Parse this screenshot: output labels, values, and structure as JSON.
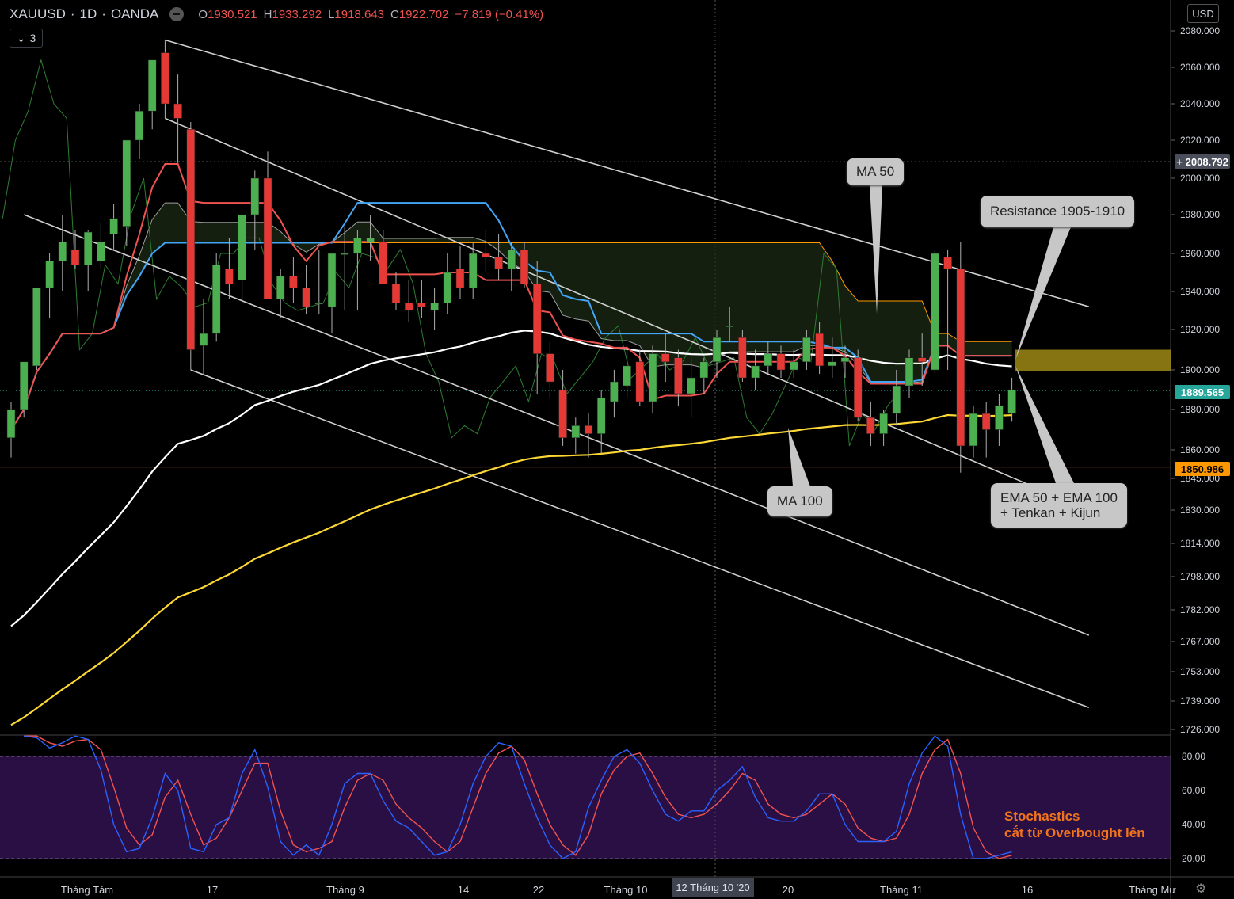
{
  "header": {
    "symbol": "XAUUSD",
    "interval": "1D",
    "source": "OANDA",
    "o_label": "O",
    "o_value": "1930.521",
    "h_label": "H",
    "h_value": "1933.292",
    "l_label": "L",
    "l_value": "1918.643",
    "c_label": "C",
    "c_value": "1922.702",
    "change": "−7.819 (−0.41%)",
    "indicator_count": "3",
    "currency_button": "USD"
  },
  "colors": {
    "background": "#000000",
    "up": "#4caf50",
    "down": "#e53935",
    "tenkan": "#ef5350",
    "kijun": "#42a5f5",
    "ma50": "#ffffff",
    "ma100": "#fdd835",
    "cloud_edge": "#9e9e9e",
    "span_b": "#ff9800",
    "lagging": "#2e7d32",
    "stoch_k": "#2962ff",
    "stoch_d": "#ef5350",
    "stoch_band": "#2a0f44",
    "channel": "#d0d0d0",
    "resistance_zone": "#b39b1a"
  },
  "annotations": {
    "ma50": "MA 50",
    "ma100": "MA 100",
    "resistance": "Resistance 1905-1910",
    "confluence_line1": "EMA 50 + EMA 100",
    "confluence_line2": "+ Tenkan + Kijun",
    "stoch_line1": "Stochastics",
    "stoch_line2": "cắt từ Overbought lên"
  },
  "price_tags": {
    "crosshair": "2008.792",
    "last": "1889.565",
    "horizontal_line": "1850.986"
  },
  "time_axis": {
    "labels": [
      "Tháng Tám",
      "17",
      "Tháng 9",
      "14",
      "22",
      "Tháng 10",
      "20",
      "Tháng 11",
      "16",
      "Tháng Mư"
    ],
    "highlight": "12 Tháng 10 '20"
  },
  "chart_data": {
    "type": "candlestick",
    "title": "XAUUSD 1D OANDA",
    "price_scale": {
      "ticks": [
        2080,
        2060,
        2040,
        2020,
        2000,
        1980,
        1960,
        1940,
        1920,
        1900,
        1880,
        1860,
        1845,
        1830,
        1814,
        1798,
        1782,
        1767,
        1753,
        1739,
        1726
      ],
      "tick_labels": [
        "2080.000",
        "2060.000",
        "2040.000",
        "2020.000",
        "2000.000",
        "1980.000",
        "1960.000",
        "1940.000",
        "1920.000",
        "1900.000",
        "1880.000",
        "1860.000",
        "1845.000",
        "1830.000",
        "1814.000",
        "1798.000",
        "1782.000",
        "1767.000",
        "1753.000",
        "1739.000",
        "1726.000"
      ]
    },
    "candles": [
      [
        1866,
        1884,
        1856,
        1880
      ],
      [
        1880,
        1904,
        1876,
        1904
      ],
      [
        1902,
        1942,
        1900,
        1942
      ],
      [
        1942,
        1960,
        1926,
        1956
      ],
      [
        1956,
        1980,
        1940,
        1966
      ],
      [
        1962,
        1972,
        1952,
        1954
      ],
      [
        1954,
        1972,
        1940,
        1971
      ],
      [
        1956,
        1976,
        1952,
        1966
      ],
      [
        1970,
        1986,
        1962,
        1978
      ],
      [
        1974,
        2020,
        1964,
        2020
      ],
      [
        2020,
        2040,
        2010,
        2036
      ],
      [
        2036,
        2064,
        2026,
        2064
      ],
      [
        2068,
        2075,
        2032,
        2040
      ],
      [
        2040,
        2056,
        2008,
        2032
      ],
      [
        2026,
        2030,
        1900,
        1910
      ],
      [
        1912,
        1936,
        1898,
        1918
      ],
      [
        1918,
        1960,
        1914,
        1954
      ],
      [
        1952,
        1968,
        1936,
        1944
      ],
      [
        1946,
        1980,
        1934,
        1980
      ],
      [
        1980,
        2004,
        1962,
        2000
      ],
      [
        2000,
        2014,
        1936,
        1936
      ],
      [
        1936,
        1952,
        1926,
        1948
      ],
      [
        1948,
        1958,
        1934,
        1942
      ],
      [
        1942,
        1954,
        1928,
        1932
      ],
      [
        1934,
        1962,
        1928,
        1934
      ],
      [
        1932,
        1954,
        1918,
        1960
      ],
      [
        1960,
        1974,
        1930,
        1960
      ],
      [
        1960,
        1972,
        1930,
        1968
      ],
      [
        1966,
        1980,
        1956,
        1968
      ],
      [
        1966,
        1972,
        1946,
        1944
      ],
      [
        1944,
        1950,
        1930,
        1934
      ],
      [
        1934,
        1946,
        1924,
        1930
      ],
      [
        1934,
        1946,
        1926,
        1932
      ],
      [
        1930,
        1942,
        1920,
        1934
      ],
      [
        1934,
        1960,
        1928,
        1950
      ],
      [
        1952,
        1964,
        1936,
        1942
      ],
      [
        1942,
        1966,
        1936,
        1960
      ],
      [
        1960,
        1972,
        1950,
        1958
      ],
      [
        1958,
        1970,
        1946,
        1952
      ],
      [
        1952,
        1966,
        1940,
        1962
      ],
      [
        1962,
        1966,
        1942,
        1944
      ],
      [
        1944,
        1956,
        1888,
        1908
      ],
      [
        1908,
        1914,
        1886,
        1894
      ],
      [
        1890,
        1900,
        1862,
        1866
      ],
      [
        1866,
        1876,
        1858,
        1872
      ],
      [
        1872,
        1878,
        1856,
        1868
      ],
      [
        1868,
        1890,
        1858,
        1886
      ],
      [
        1884,
        1900,
        1876,
        1894
      ],
      [
        1892,
        1912,
        1886,
        1902
      ],
      [
        1904,
        1910,
        1882,
        1884
      ],
      [
        1884,
        1912,
        1878,
        1908
      ],
      [
        1908,
        1918,
        1894,
        1904
      ],
      [
        1906,
        1910,
        1882,
        1888
      ],
      [
        1888,
        1906,
        1876,
        1896
      ],
      [
        1896,
        1906,
        1888,
        1904
      ],
      [
        1904,
        1920,
        1896,
        1916
      ],
      [
        1922,
        1932,
        1914,
        1922
      ],
      [
        1916,
        1920,
        1894,
        1896
      ],
      [
        1896,
        1910,
        1890,
        1902
      ],
      [
        1902,
        1914,
        1898,
        1908
      ],
      [
        1908,
        1912,
        1896,
        1900
      ],
      [
        1900,
        1910,
        1896,
        1904
      ],
      [
        1904,
        1920,
        1900,
        1916
      ],
      [
        1918,
        1924,
        1898,
        1902
      ],
      [
        1902,
        1916,
        1896,
        1904
      ],
      [
        1904,
        1912,
        1896,
        1906
      ],
      [
        1906,
        1910,
        1874,
        1876
      ],
      [
        1876,
        1884,
        1862,
        1868
      ],
      [
        1868,
        1880,
        1862,
        1878
      ],
      [
        1878,
        1900,
        1872,
        1892
      ],
      [
        1892,
        1910,
        1886,
        1906
      ],
      [
        1906,
        1918,
        1892,
        1904
      ],
      [
        1900,
        1962,
        1898,
        1960
      ],
      [
        1958,
        1962,
        1900,
        1952
      ],
      [
        1952,
        1966,
        1848,
        1862
      ],
      [
        1862,
        1882,
        1856,
        1878
      ],
      [
        1878,
        1884,
        1856,
        1870
      ],
      [
        1870,
        1888,
        1862,
        1882
      ],
      [
        1878,
        1896,
        1874,
        1890
      ]
    ],
    "channel_lines": [
      {
        "from": [
          12,
          2075
        ],
        "to": [
          84,
          1932
        ]
      },
      {
        "from": [
          12,
          2032
        ],
        "to": [
          84,
          1830
        ]
      },
      {
        "from": [
          1,
          1980
        ],
        "to": [
          84,
          1770
        ]
      },
      {
        "from": [
          14,
          1900
        ],
        "to": [
          84,
          1736
        ]
      }
    ],
    "stochastic": {
      "ticks": [
        80,
        60,
        40,
        20
      ],
      "overbought": 80,
      "oversold": 20,
      "k": [
        92,
        91,
        85,
        88,
        92,
        90,
        72,
        40,
        24,
        26,
        44,
        70,
        60,
        26,
        24,
        40,
        44,
        70,
        84,
        62,
        30,
        22,
        28,
        22,
        40,
        64,
        70,
        70,
        54,
        42,
        38,
        30,
        22,
        24,
        40,
        64,
        80,
        88,
        86,
        64,
        44,
        28,
        20,
        24,
        50,
        66,
        80,
        84,
        76,
        60,
        46,
        42,
        48,
        48,
        60,
        66,
        74,
        56,
        44,
        42,
        42,
        48,
        58,
        58,
        40,
        30,
        30,
        30,
        36,
        64,
        82,
        92,
        86,
        46,
        20,
        20,
        22,
        24
      ],
      "d": [
        92,
        92,
        88,
        86,
        89,
        90,
        84,
        62,
        38,
        28,
        34,
        56,
        66,
        46,
        28,
        32,
        44,
        60,
        76,
        76,
        48,
        28,
        24,
        26,
        30,
        50,
        66,
        70,
        66,
        52,
        44,
        38,
        30,
        24,
        30,
        50,
        70,
        82,
        86,
        78,
        58,
        40,
        28,
        22,
        34,
        58,
        72,
        80,
        82,
        70,
        56,
        46,
        44,
        46,
        52,
        60,
        70,
        66,
        52,
        46,
        44,
        46,
        52,
        58,
        52,
        38,
        32,
        30,
        32,
        46,
        70,
        84,
        90,
        70,
        38,
        24,
        20,
        22
      ]
    }
  }
}
